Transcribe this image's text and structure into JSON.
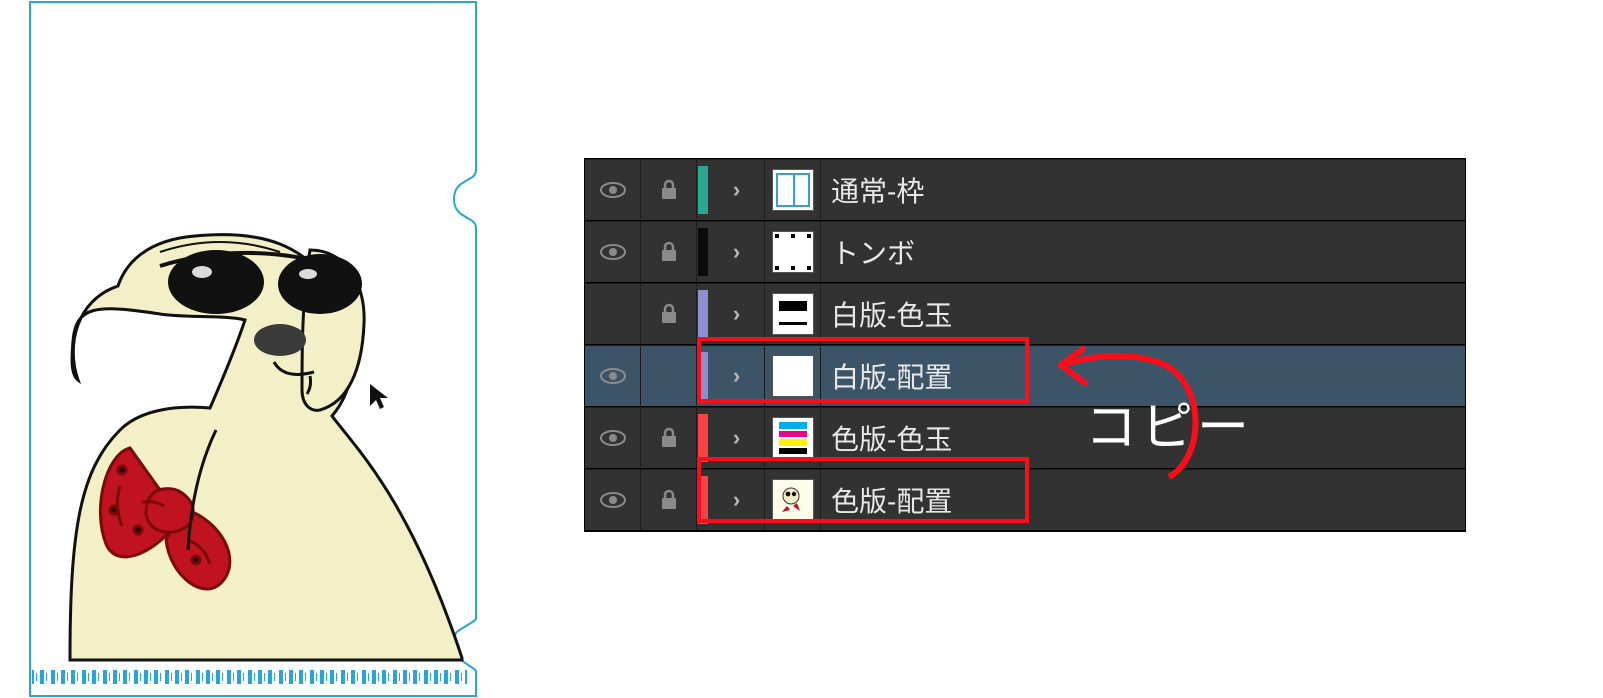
{
  "artwork": {
    "description": "clear-file-dog-illustration"
  },
  "layers": [
    {
      "name": "通常-枠",
      "color": "#2aa792",
      "visible": true,
      "locked": true,
      "selected": false,
      "thumb": "frame"
    },
    {
      "name": "トンボ",
      "color": "#0b0b0b",
      "visible": true,
      "locked": true,
      "selected": false,
      "thumb": "tonbo"
    },
    {
      "name": "白版-色玉",
      "color": "#8d8fd1",
      "visible": false,
      "locked": true,
      "selected": false,
      "thumb": "irotama"
    },
    {
      "name": "白版-配置",
      "color": "#8d8fd1",
      "visible": true,
      "locked": false,
      "selected": true,
      "thumb": "blank"
    },
    {
      "name": "色版-色玉",
      "color": "#fc4242",
      "visible": true,
      "locked": true,
      "selected": false,
      "thumb": "cmyk"
    },
    {
      "name": "色版-配置",
      "color": "#fc4242",
      "visible": true,
      "locked": true,
      "selected": false,
      "thumb": "dog"
    }
  ],
  "annotations": {
    "copy_label": "コピー",
    "highlight_indices": [
      3,
      5
    ],
    "arrow_from_index": 5,
    "arrow_to_index": 3
  },
  "cmyk": {
    "c": "#00aeef",
    "m": "#ec008c",
    "y": "#fff200",
    "k": "#000000"
  }
}
